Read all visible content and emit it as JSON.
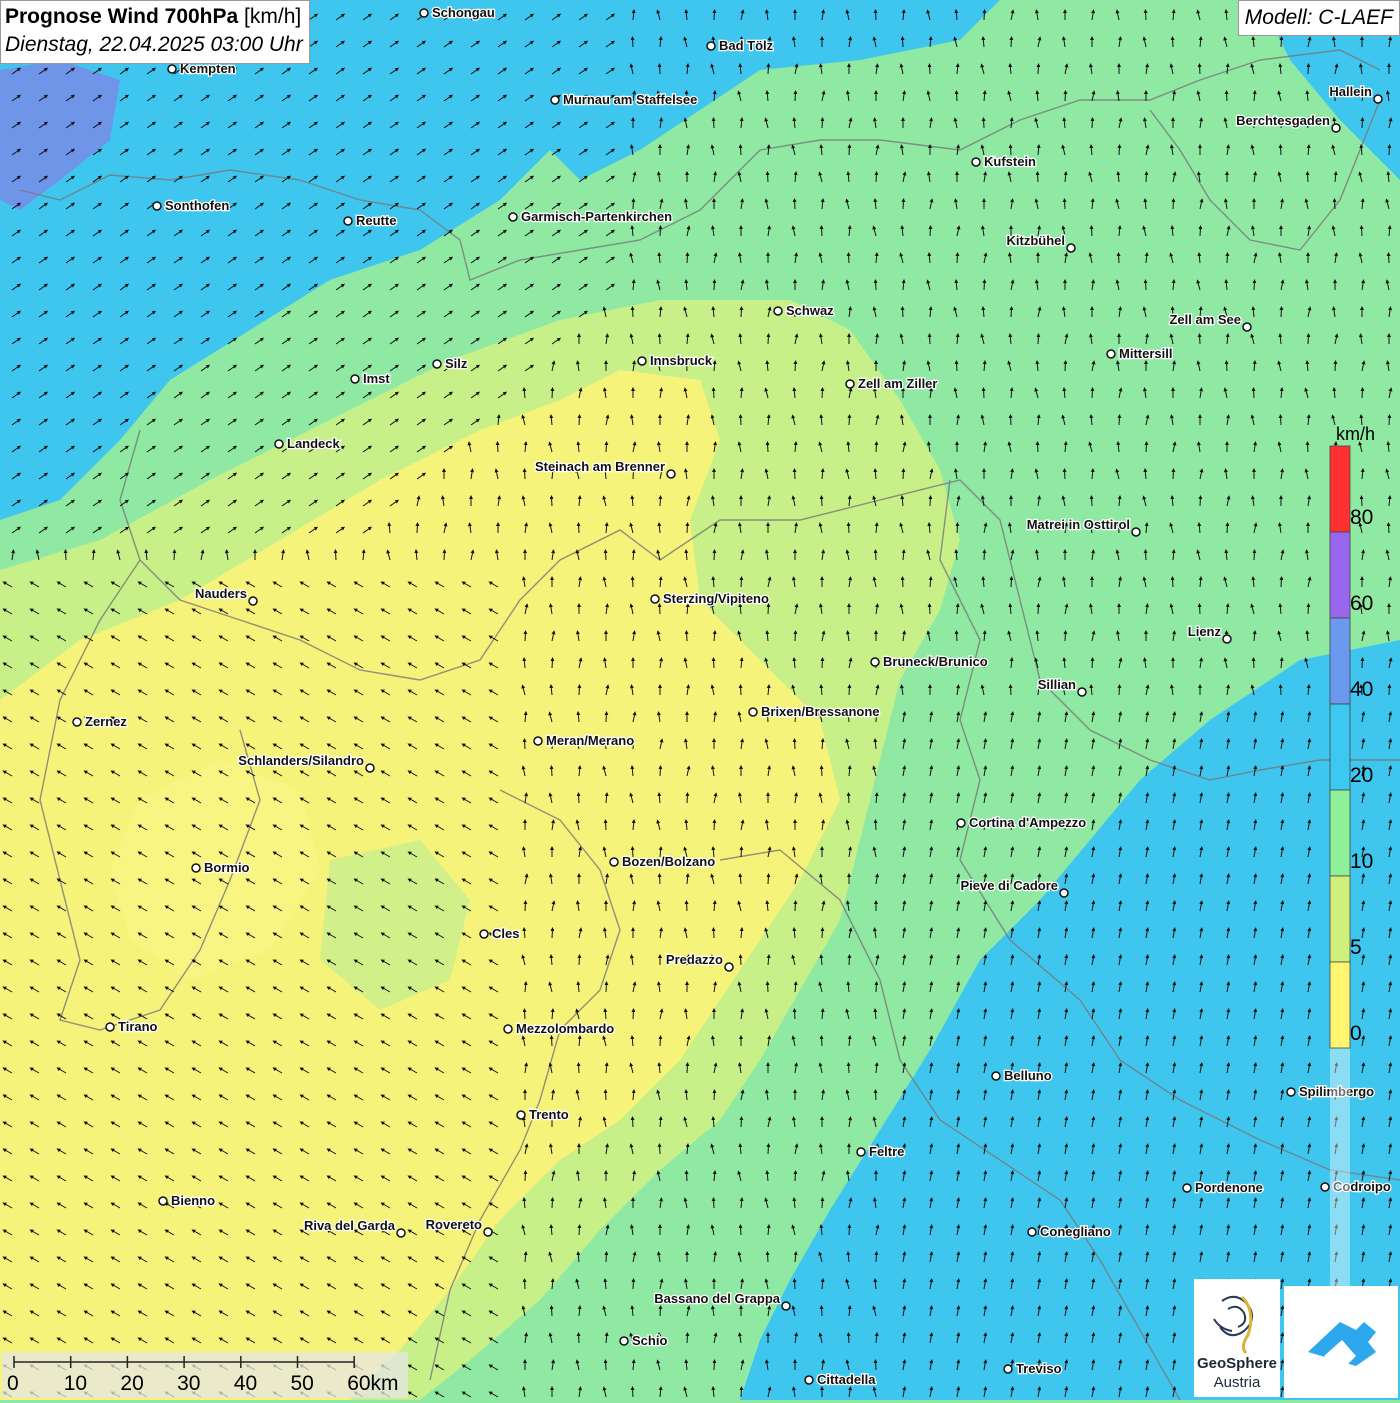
{
  "title": {
    "main": "Prognose Wind 700hPa",
    "unit": "[km/h]",
    "datetime": "Dienstag, 22.04.2025 03:00 Uhr"
  },
  "model": "Modell: C-LAEF",
  "legend": {
    "unit": "km/h",
    "labels": [
      "80",
      "60",
      "40",
      "20",
      "10",
      "5",
      "0"
    ],
    "colors": [
      "#ff3030",
      "#9966ee",
      "#6a99ee",
      "#3cc8f0",
      "#8ff09a",
      "#cff07a",
      "#fff570"
    ]
  },
  "scalebar": {
    "labels": [
      "0",
      "10",
      "20",
      "30",
      "40",
      "50",
      "60km"
    ]
  },
  "logos": {
    "geosphere_line1": "GeoSphere",
    "geosphere_line2": "Austria"
  },
  "cities": [
    {
      "name": "Schongau"
    },
    {
      "name": "Bad Tölz"
    },
    {
      "name": "Kempten"
    },
    {
      "name": "Murnau am Staffelsee"
    },
    {
      "name": "Hallein"
    },
    {
      "name": "Berchtesgaden"
    },
    {
      "name": "Kufstein"
    },
    {
      "name": "Sonthofen"
    },
    {
      "name": "Reutte"
    },
    {
      "name": "Garmisch-Partenkirchen"
    },
    {
      "name": "Kitzbühel"
    },
    {
      "name": "Schwaz"
    },
    {
      "name": "Zell am See"
    },
    {
      "name": "Innsbruck"
    },
    {
      "name": "Silz"
    },
    {
      "name": "Imst"
    },
    {
      "name": "Mittersill"
    },
    {
      "name": "Zell am Ziller"
    },
    {
      "name": "Landeck"
    },
    {
      "name": "Steinach am Brenner"
    },
    {
      "name": "Matrei in Osttirol"
    },
    {
      "name": "Nauders"
    },
    {
      "name": "Sterzing/Vipiteno"
    },
    {
      "name": "Lienz"
    },
    {
      "name": "Bruneck/Brunico"
    },
    {
      "name": "Sillian"
    },
    {
      "name": "Brixen/Bressanone"
    },
    {
      "name": "Zernez"
    },
    {
      "name": "Meran/Merano"
    },
    {
      "name": "Schlanders/Silandro"
    },
    {
      "name": "Cortina d'Ampezzo"
    },
    {
      "name": "Bozen/Bolzano"
    },
    {
      "name": "Bormio"
    },
    {
      "name": "Pieve di Cadore"
    },
    {
      "name": "Cles"
    },
    {
      "name": "Predazzo"
    },
    {
      "name": "Tirano"
    },
    {
      "name": "Mezzolombardo"
    },
    {
      "name": "Belluno"
    },
    {
      "name": "Spilimbergo"
    },
    {
      "name": "Trento"
    },
    {
      "name": "Feltre"
    },
    {
      "name": "Bienno"
    },
    {
      "name": "Pordenone"
    },
    {
      "name": "Codroipo"
    },
    {
      "name": "Riva del Garda"
    },
    {
      "name": "Rovereto"
    },
    {
      "name": "Conegliano"
    },
    {
      "name": "Bassano del Grappa"
    },
    {
      "name": "Schio"
    },
    {
      "name": "Treviso"
    },
    {
      "name": "Cittadella"
    }
  ]
}
